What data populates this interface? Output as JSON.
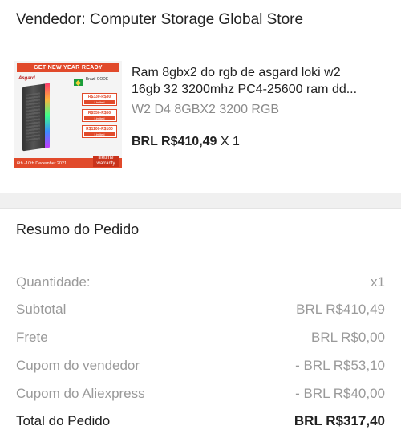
{
  "seller": {
    "label": "Vendedor: Computer Storage Global Store"
  },
  "product": {
    "title_line1": "Ram 8gbx2 do rgb de asgard loki w2",
    "title_line2": "16gb 32 3200mhz PC4-25600 ram dd...",
    "variant": "W2 D4 8GBX2 3200 RGB",
    "price": "BRL R$410,49",
    "quantity": "X 1",
    "image": {
      "banner": "GET NEW YEAR READY",
      "brand": "Asgard",
      "flag_text": "Brazil CODE",
      "coupons": [
        "R$330-R$30",
        "R$550-R$50",
        "R$1100-R$100"
      ],
      "coupon_tag": "Limited",
      "dates": "6th.-10th.December.2021",
      "warranty": "lifetime warranty"
    }
  },
  "summary": {
    "title": "Resumo do Pedido",
    "rows": [
      {
        "label": "Quantidade:",
        "value": "x1"
      },
      {
        "label": "Subtotal",
        "value": "BRL R$410,49"
      },
      {
        "label": "Frete",
        "value": "BRL R$0,00"
      },
      {
        "label": "Cupom do vendedor",
        "value": "- BRL R$53,10"
      },
      {
        "label": "Cupom do Aliexpress",
        "value": "- BRL R$40,00"
      }
    ],
    "total": {
      "label": "Total do Pedido",
      "value": "BRL R$317,40"
    }
  }
}
